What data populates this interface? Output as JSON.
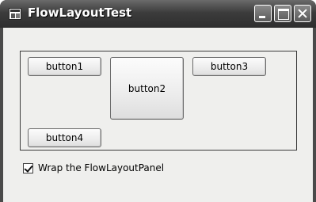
{
  "window": {
    "title": "FlowLayoutTest",
    "controls": {
      "minimize": "minimize",
      "maximize": "maximize",
      "close": "close"
    }
  },
  "flow_panel": {
    "buttons": [
      {
        "label": "button1"
      },
      {
        "label": "button2"
      },
      {
        "label": "button3"
      },
      {
        "label": "button4"
      }
    ]
  },
  "wrap_checkbox": {
    "label": "Wrap the FlowLayoutPanel",
    "checked": true
  }
}
